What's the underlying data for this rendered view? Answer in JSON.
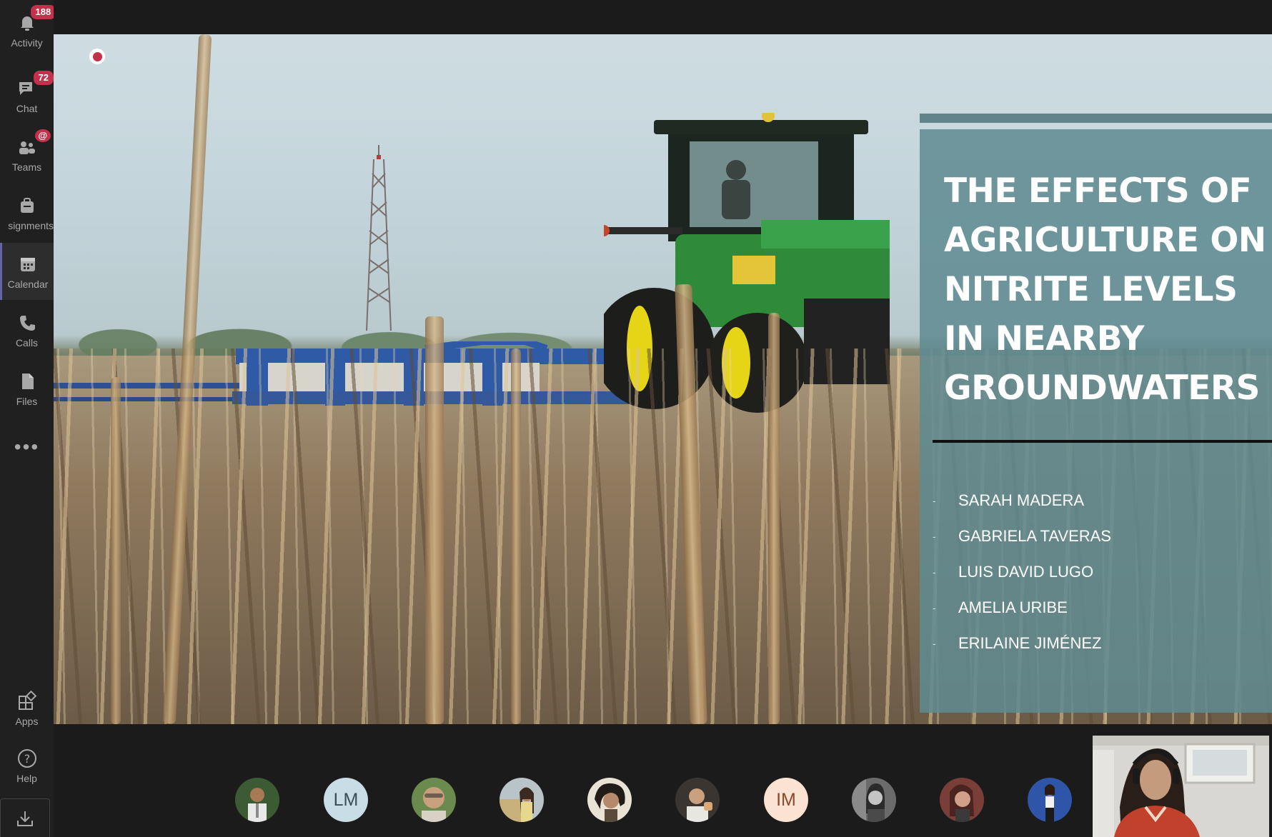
{
  "rail": {
    "activity": {
      "label": "Activity",
      "badge": "188"
    },
    "chat": {
      "label": "Chat",
      "badge": "72"
    },
    "teams": {
      "label": "Teams",
      "badge": "@"
    },
    "assignments": {
      "label": "Assignments",
      "visible_text": "signments"
    },
    "calendar": {
      "label": "Calendar"
    },
    "calls": {
      "label": "Calls"
    },
    "files": {
      "label": "Files"
    },
    "more": {
      "icon": "more-dots-icon"
    },
    "apps": {
      "label": "Apps"
    },
    "help": {
      "label": "Help"
    },
    "download": {
      "icon": "download-icon"
    }
  },
  "slide": {
    "title_lines": [
      "THE EFFECTS OF",
      "AGRICULTURE ON",
      "NITRITE LEVELS",
      "IN NEARBY",
      "GROUNDWATERS"
    ],
    "authors": [
      "SARAH MADERA",
      "GABRIELA TAVERAS",
      "LUIS DAVID LUGO",
      "AMELIA URIBE",
      "ERILAINE JIMÉNEZ"
    ],
    "card_color": "#608a91"
  },
  "participants": [
    {
      "type": "photo",
      "tone": "#3c5a34"
    },
    {
      "type": "initials",
      "initials": "LM",
      "bg": "#c8dde6",
      "fg": "#3b4d57"
    },
    {
      "type": "photo",
      "tone": "#6a8a4e"
    },
    {
      "type": "photo",
      "tone": "#c8b07a"
    },
    {
      "type": "photo",
      "tone": "#d9c9a8"
    },
    {
      "type": "photo",
      "tone": "#3a3530"
    },
    {
      "type": "initials",
      "initials": "IM",
      "bg": "#fbe3d4",
      "fg": "#8c4a2a"
    },
    {
      "type": "photo",
      "tone": "#6b6b6b"
    },
    {
      "type": "photo",
      "tone": "#7a3e38"
    },
    {
      "type": "photo",
      "tone": "#2f55a8"
    }
  ],
  "colors": {
    "accent": "#6264a7",
    "badge": "#c4314b",
    "rail_bg": "#202020"
  }
}
